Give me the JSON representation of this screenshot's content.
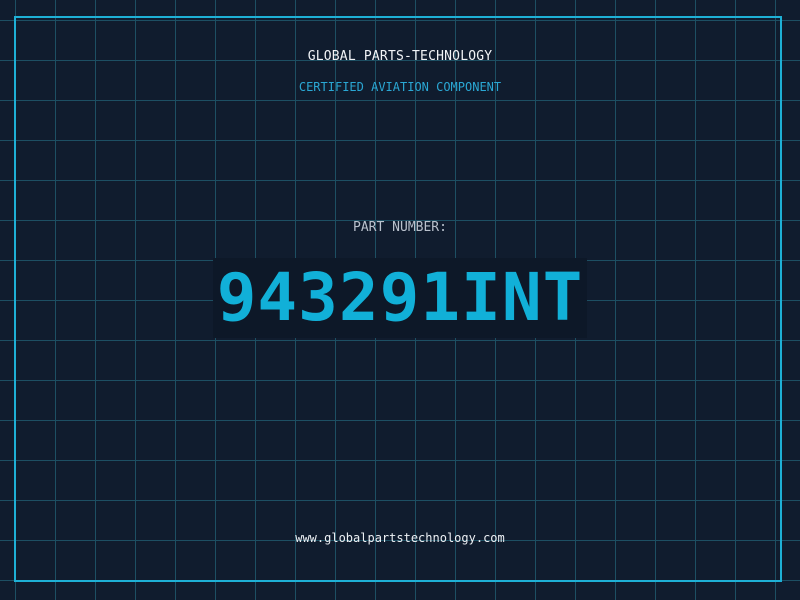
{
  "label": {
    "company": "GLOBAL PARTS-TECHNOLOGY",
    "certification": "CERTIFIED AVIATION COMPONENT",
    "part_label": "PART NUMBER:",
    "part_number": "943291INT",
    "website": "www.globalpartstechnology.com"
  },
  "colors": {
    "background": "#101c2e",
    "grid": "#1d4f63",
    "frame": "#1eb0d6",
    "accent": "#11b0d8"
  }
}
